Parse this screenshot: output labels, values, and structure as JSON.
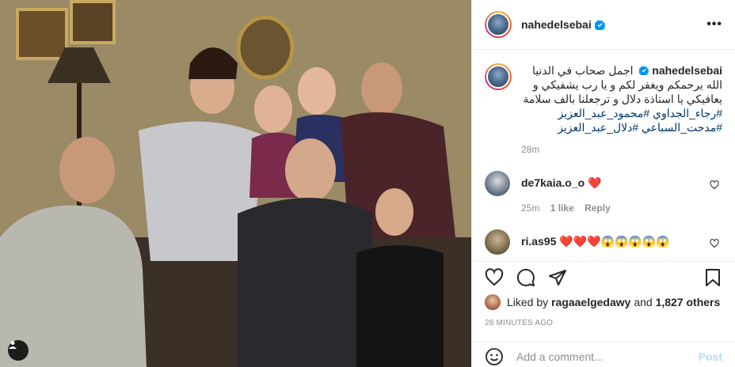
{
  "post": {
    "username": "nahedelsebai",
    "caption": {
      "username": "nahedelsebai",
      "text": "اجمل صحاب في الدنيا الله يرحمكم ويغفر لكم و يا رب يشفيكي و يعافيكي يا استاذة دلال و ترجعلنا بالف سلامة",
      "hashtags": [
        "#رجاء_الجداوي",
        "#محمود_عبد_العزيز",
        "#مدحت_السباعي",
        "#دلال_عبد_العزيز"
      ],
      "time": "28m"
    },
    "comments": [
      {
        "username": "de7kaia.o_o",
        "text": "❤️",
        "time": "25m",
        "likes": "1 like",
        "reply": "Reply",
        "avatar_color": "#6b7a8a"
      },
      {
        "username": "ri.as95",
        "text": "❤️❤️❤️😱😱😱😱😱",
        "avatar_color": "#7a6a4a"
      }
    ],
    "liked_by_prefix": "Liked by",
    "liked_by_user": "ragaaelgedawy",
    "liked_by_and": "and",
    "liked_by_count": "1,827 others",
    "posted_ago": "28 MINUTES AGO",
    "add_comment_placeholder": "Add a comment...",
    "post_button": "Post",
    "more_icon": "•••"
  },
  "icons": {
    "verified": "verified-badge-icon",
    "like": "heart-icon",
    "comment": "comment-icon",
    "share": "paper-plane-icon",
    "save": "bookmark-icon",
    "emoji": "smiley-icon",
    "tag": "user-tag-icon"
  },
  "colors": {
    "verified_blue": "#0095f6",
    "hashtag": "#00376b",
    "secondary_text": "#8e8e8e",
    "post_button_disabled": "#b2dffc",
    "heart_red": "#ed4956"
  }
}
